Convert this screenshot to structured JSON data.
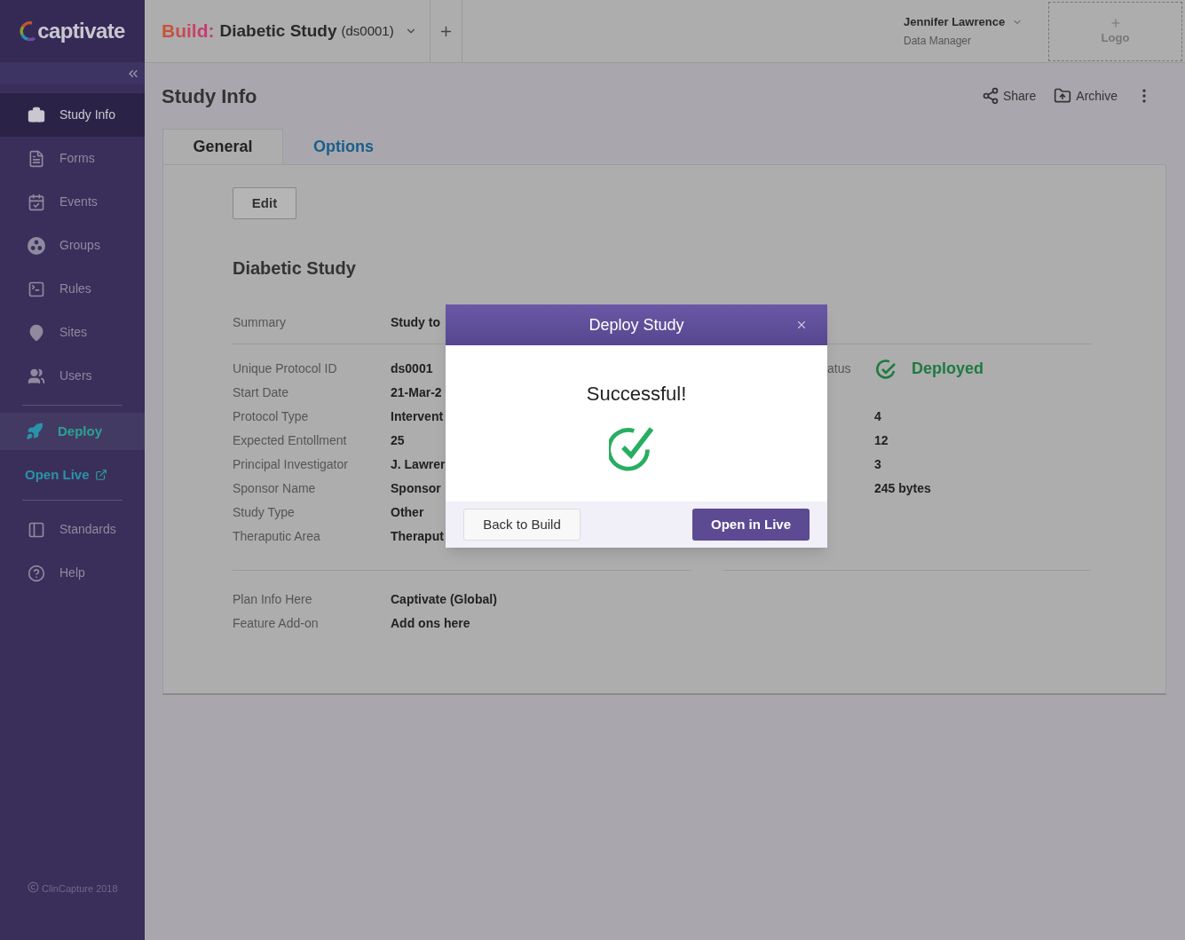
{
  "sidebar": {
    "brand": "captivate",
    "items": [
      {
        "label": "Study Info",
        "selected": true
      },
      {
        "label": "Forms",
        "selected": false
      },
      {
        "label": "Events",
        "selected": false
      },
      {
        "label": "Groups",
        "selected": false
      },
      {
        "label": "Rules",
        "selected": false
      },
      {
        "label": "Sites",
        "selected": false
      },
      {
        "label": "Users",
        "selected": false
      }
    ],
    "deploy": {
      "label": "Deploy",
      "active": true
    },
    "open_live": "Open Live",
    "help_items": [
      {
        "label": "Standards"
      },
      {
        "label": "Help"
      }
    ],
    "footer": "ClinCapture 2018"
  },
  "header": {
    "mode": "Build:",
    "study": "Diabetic Study",
    "study_id": "(ds0001)",
    "user_name": "Jennifer Lawrence",
    "user_role": "Data Manager",
    "logo_placeholder": "Logo"
  },
  "page": {
    "title": "Study Info",
    "actions": [
      "Share",
      "Archive"
    ],
    "tabs": [
      {
        "label": "General",
        "selected": true
      },
      {
        "label": "Options",
        "selected": false
      }
    ],
    "edit_button": "Edit",
    "study_name": "Diabetic Study",
    "summary": {
      "label": "Summary",
      "value": "Study to"
    },
    "details": [
      {
        "label": "Unique Protocol ID",
        "value": "ds0001"
      },
      {
        "label": "Start Date",
        "value": "21-Mar-2"
      },
      {
        "label": "Protocol Type",
        "value": "Intervent"
      },
      {
        "label": "Expected Entollment",
        "value": "25"
      },
      {
        "label": "Principal Investigator",
        "value": "J. Lawrer"
      },
      {
        "label": "Sponsor Name",
        "value": "Sponsor"
      },
      {
        "label": "Study Type",
        "value": "Other"
      },
      {
        "label": "Theraputic Area",
        "value": "Theraput"
      }
    ],
    "status": {
      "label": "atus",
      "value": "Deployed"
    },
    "stats": [
      "4",
      "12",
      "3",
      "245 bytes"
    ],
    "plan": [
      {
        "label": "Plan Info Here",
        "value": "Captivate (Global)"
      },
      {
        "label": "Feature Add-on",
        "value": "Add ons here"
      }
    ]
  },
  "dialog": {
    "title": "Deploy Study",
    "message": "Successful!",
    "buttons": [
      {
        "label": "Back to Build",
        "kind": "secondary"
      },
      {
        "label": "Open in Live",
        "kind": "primary"
      }
    ]
  }
}
